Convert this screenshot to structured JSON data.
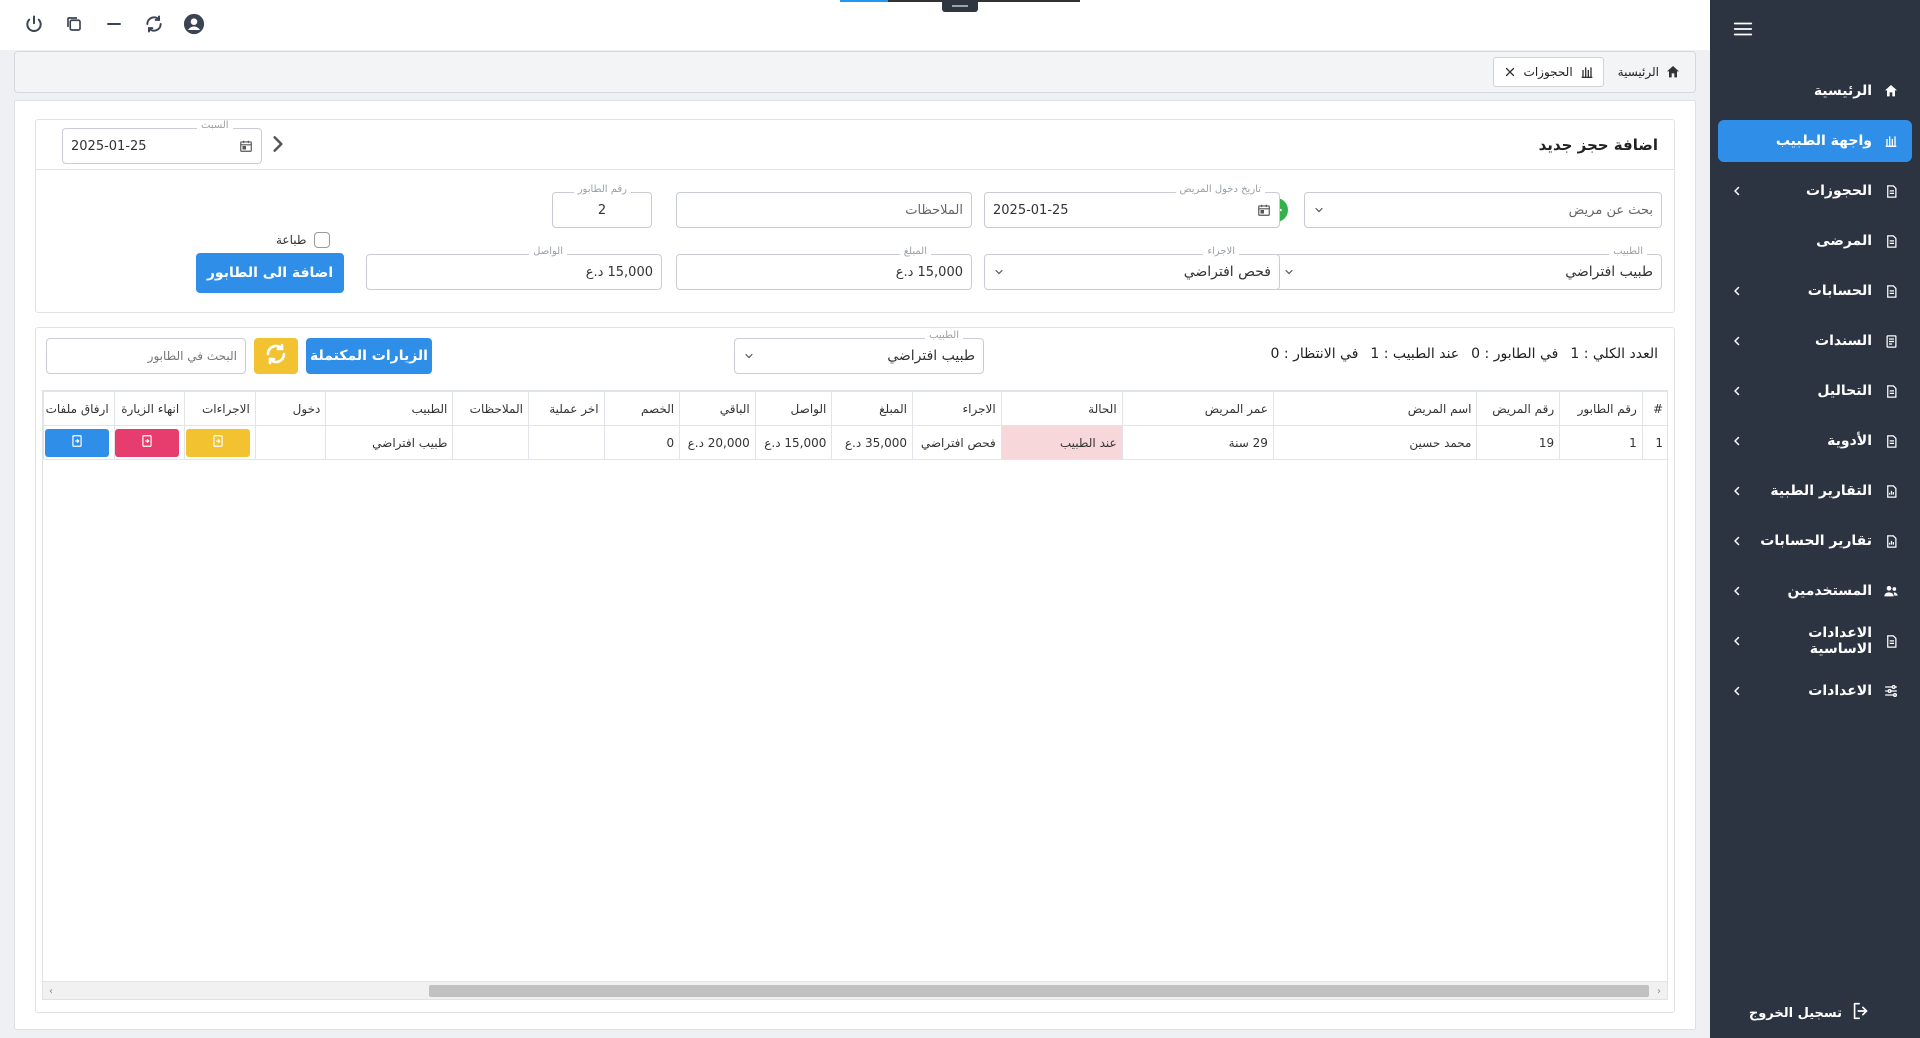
{
  "sidebar": {
    "items": [
      {
        "label": "الرئيسية",
        "icon": "home-icon",
        "has_children": false,
        "active": false
      },
      {
        "label": "واجهة الطبيب",
        "icon": "monitor-icon",
        "has_children": false,
        "active": true
      },
      {
        "label": "الحجوزات",
        "icon": "document-icon",
        "has_children": true,
        "active": false
      },
      {
        "label": "المرضى",
        "icon": "document-icon",
        "has_children": false,
        "active": false
      },
      {
        "label": "الحسابات",
        "icon": "document-icon",
        "has_children": true,
        "active": false
      },
      {
        "label": "السندات",
        "icon": "receipt-icon",
        "has_children": true,
        "active": false
      },
      {
        "label": "التحاليل",
        "icon": "document-icon",
        "has_children": true,
        "active": false
      },
      {
        "label": "الأدوية",
        "icon": "document-icon",
        "has_children": true,
        "active": false
      },
      {
        "label": "التقارير الطبية",
        "icon": "report-icon",
        "has_children": true,
        "active": false
      },
      {
        "label": "تقارير الحسابات",
        "icon": "report-icon",
        "has_children": true,
        "active": false
      },
      {
        "label": "المستخدمين",
        "icon": "users-icon",
        "has_children": true,
        "active": false
      },
      {
        "label": "الاعدادات الاساسية",
        "icon": "document-icon",
        "has_children": true,
        "active": false
      },
      {
        "label": "الاعدادات",
        "icon": "sliders-icon",
        "has_children": true,
        "active": false
      }
    ],
    "logout_label": "تسجيل الخروج"
  },
  "breadcrumb": {
    "home_label": "الرئيسية",
    "tab_label": "الحجوزات"
  },
  "booking_form": {
    "title": "اضافة حجز جديد",
    "date_filter": {
      "label": "السبت",
      "value": "2025-01-25"
    },
    "patient_search": {
      "placeholder": "بحث عن مريض"
    },
    "entry_date": {
      "label": "تاريخ دخول المريض",
      "value": "2025-01-25"
    },
    "notes": {
      "placeholder": "الملاحظات"
    },
    "queue_number": {
      "label": "رقم الطابور",
      "value": "2"
    },
    "doctor": {
      "label": "الطبيب",
      "value": "طبيب افتراضي"
    },
    "procedure": {
      "label": "الاجراء",
      "value": "فحص افتراضي"
    },
    "amount": {
      "label": "المبلغ",
      "value": "15,000 د.ع"
    },
    "received": {
      "label": "الواصل",
      "value": "15,000 د.ع"
    },
    "print_label": "طباعة",
    "add_button": "اضافة الى الطابور"
  },
  "queue": {
    "counts": {
      "total_label": "العدد الكلي :",
      "total": "1",
      "in_queue_label": "في الطابور :",
      "in_queue": "0",
      "with_doctor_label": "عند الطبيب :",
      "with_doctor": "1",
      "waiting_label": "في الانتظار :",
      "waiting": "0"
    },
    "doctor_filter": {
      "label": "الطبيب",
      "value": "طبيب افتراضي"
    },
    "completed_button": "الزيارات المكتملة",
    "search": {
      "placeholder": "البحث في الطابور"
    },
    "columns": [
      "#",
      "رقم الطابور",
      "رقم المريض",
      "اسم المريض",
      "عمر المريض",
      "الحالة",
      "الاجراء",
      "المبلغ",
      "الواصل",
      "الباقي",
      "الخصم",
      "اخر عملية",
      "الملاحظات",
      "الطبيب",
      "دخول",
      "الاجراءات",
      "انهاء الزيارة",
      "ارفاق ملفات"
    ],
    "rows": [
      {
        "index": "1",
        "queue_no": "1",
        "patient_no": "19",
        "patient_name": "محمد حسين",
        "age": "29 سنة",
        "status": "عند الطبيب",
        "procedure": "فحص افتراضي",
        "amount": "35,000 د.ع",
        "received": "15,000 د.ع",
        "remaining": "20,000 د.ع",
        "discount": "0",
        "last_operation": "",
        "notes": "",
        "doctor": "طبيب افتراضي",
        "entry": ""
      }
    ]
  },
  "colors": {
    "sidebar_bg": "#2b3440",
    "accent": "#2f8fe8",
    "status_bg": "#f8d7da",
    "yellow": "#f2c230",
    "pink": "#e73d6e",
    "green": "#34b24a"
  }
}
